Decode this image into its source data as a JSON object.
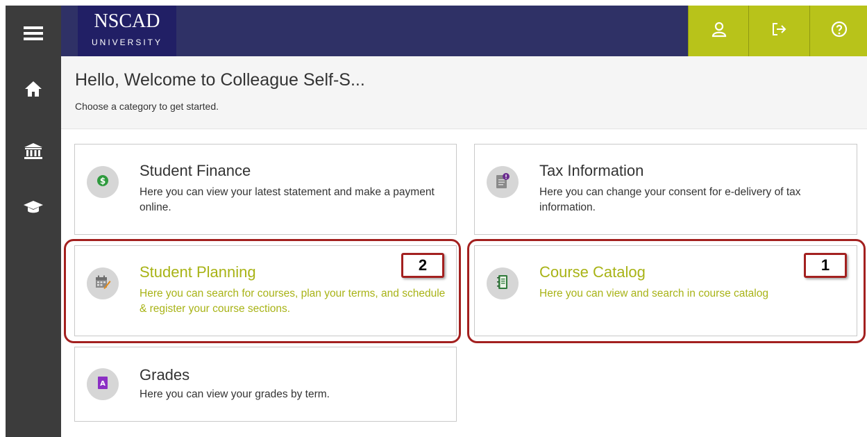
{
  "sidebar": {
    "items": [
      {
        "icon": "menu-icon"
      },
      {
        "icon": "home-icon"
      },
      {
        "icon": "finance-institution-icon"
      },
      {
        "icon": "graduation-cap-icon"
      }
    ]
  },
  "header": {
    "logo_main": "NSCAD",
    "logo_sub": "UNIVERSITY",
    "buttons": [
      {
        "icon": "user-icon"
      },
      {
        "icon": "sign-out-icon"
      },
      {
        "icon": "help-icon"
      }
    ],
    "accent_color": "#b8c31a",
    "bar_color": "#2f3166"
  },
  "welcome": {
    "title": "Hello, Welcome to Colleague Self-S...",
    "subtitle": "Choose a category to get started."
  },
  "cards": [
    {
      "title": "Student Finance",
      "description": "Here you can view your latest statement and make a payment online.",
      "icon": "dollar-icon"
    },
    {
      "title": "Tax Information",
      "description": "Here you can change your consent for e-delivery of tax information.",
      "icon": "tax-document-icon"
    },
    {
      "title": "Student Planning",
      "description": "Here you can search for courses, plan your terms, and schedule & register your course sections.",
      "icon": "calendar-icon"
    },
    {
      "title": "Course Catalog",
      "description": "Here you can view and search in course catalog",
      "icon": "catalog-book-icon"
    },
    {
      "title": "Grades",
      "description": "Here you can view your grades by term.",
      "icon": "grades-icon"
    }
  ],
  "callouts": {
    "student_planning": "2",
    "course_catalog": "1"
  }
}
